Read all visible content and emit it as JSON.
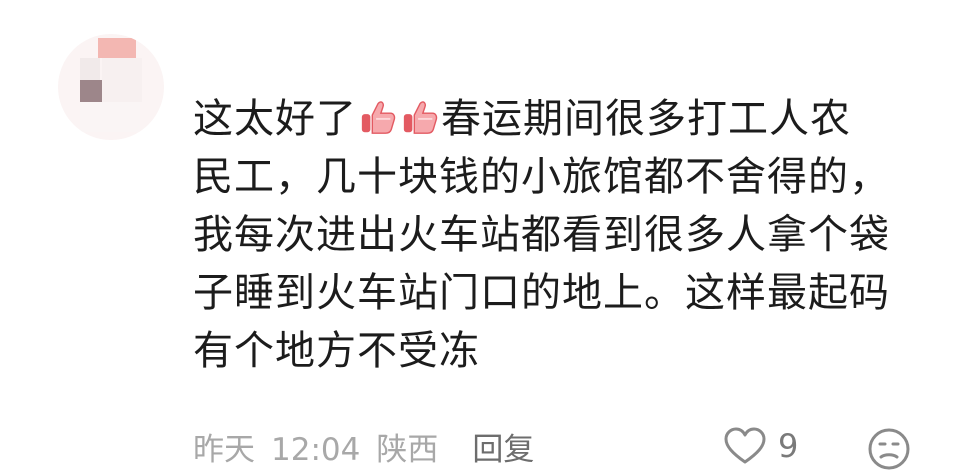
{
  "comment": {
    "line1_a": "这太好了",
    "line1_b": "春运期间很多打工人农",
    "line2": "民工，几十块钱的小旅馆都不舍得的，",
    "line3": "我每次进出火车站都看到很多人拿个袋",
    "line4": "子睡到火车站门口的地上。这样最起码",
    "line5": "有个地方不受冻",
    "emoji_icons": [
      "thumbs-up-icon",
      "thumbs-up-icon"
    ]
  },
  "meta": {
    "date": "昨天",
    "time": "12:04",
    "location": "陕西",
    "reply_label": "回复"
  },
  "actions": {
    "like_count": "9",
    "like_icon": "heart-outline-icon",
    "dislike_icon": "unhappy-face-icon"
  },
  "colors": {
    "text": "#1c1c1c",
    "meta": "#a8a8a8",
    "thumb": "#f08f93"
  }
}
